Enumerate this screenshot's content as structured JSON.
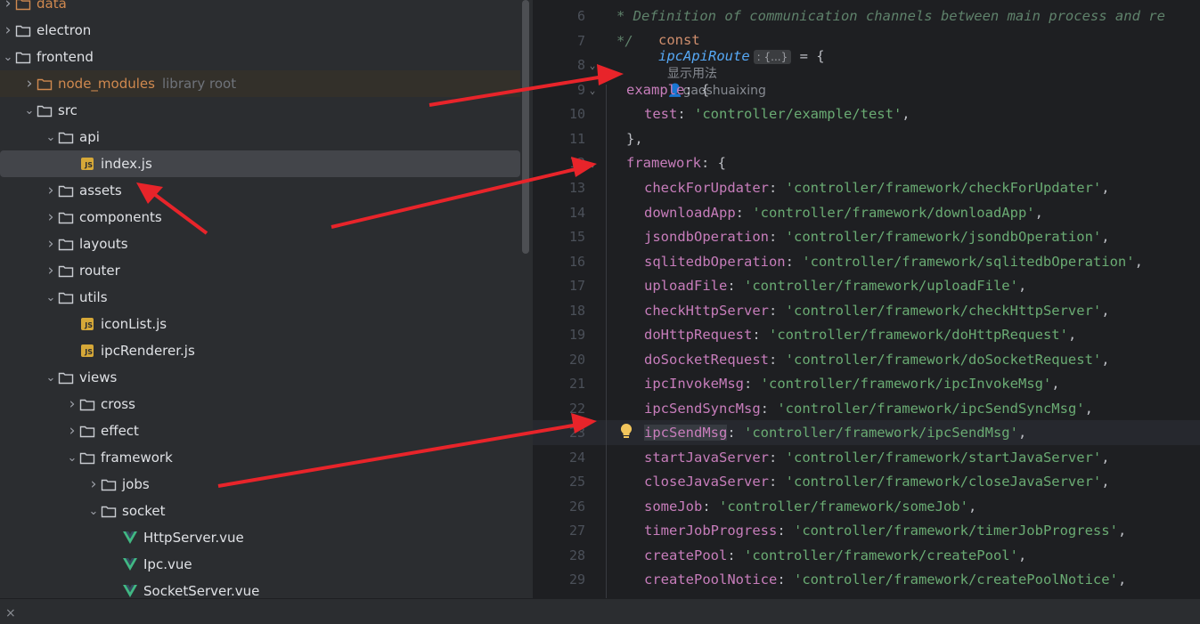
{
  "project_tree": {
    "items": [
      {
        "label": "data",
        "kind": "folder",
        "depth": 0,
        "expanded": false,
        "color": "orange"
      },
      {
        "label": "electron",
        "kind": "folder",
        "depth": 0,
        "expanded": false
      },
      {
        "label": "frontend",
        "kind": "folder",
        "depth": 0,
        "expanded": true
      },
      {
        "label": "node_modules",
        "kind": "folder",
        "depth": 1,
        "expanded": false,
        "color": "orange",
        "hint": "library root"
      },
      {
        "label": "src",
        "kind": "folder",
        "depth": 1,
        "expanded": true
      },
      {
        "label": "api",
        "kind": "folder",
        "depth": 2,
        "expanded": true
      },
      {
        "label": "index.js",
        "kind": "js",
        "depth": 3,
        "selected": true
      },
      {
        "label": "assets",
        "kind": "folder",
        "depth": 2,
        "expanded": false
      },
      {
        "label": "components",
        "kind": "folder",
        "depth": 2,
        "expanded": false
      },
      {
        "label": "layouts",
        "kind": "folder",
        "depth": 2,
        "expanded": false
      },
      {
        "label": "router",
        "kind": "folder",
        "depth": 2,
        "expanded": false
      },
      {
        "label": "utils",
        "kind": "folder",
        "depth": 2,
        "expanded": true
      },
      {
        "label": "iconList.js",
        "kind": "js",
        "depth": 3
      },
      {
        "label": "ipcRenderer.js",
        "kind": "js",
        "depth": 3
      },
      {
        "label": "views",
        "kind": "folder",
        "depth": 2,
        "expanded": true
      },
      {
        "label": "cross",
        "kind": "folder",
        "depth": 3,
        "expanded": false
      },
      {
        "label": "effect",
        "kind": "folder",
        "depth": 3,
        "expanded": false
      },
      {
        "label": "framework",
        "kind": "folder",
        "depth": 3,
        "expanded": true
      },
      {
        "label": "jobs",
        "kind": "folder",
        "depth": 4,
        "expanded": false
      },
      {
        "label": "socket",
        "kind": "folder",
        "depth": 4,
        "expanded": true
      },
      {
        "label": "HttpServer.vue",
        "kind": "vue",
        "depth": 5
      },
      {
        "label": "Ipc.vue",
        "kind": "vue",
        "depth": 5
      },
      {
        "label": "SocketServer.vue",
        "kind": "vue",
        "depth": 5
      }
    ]
  },
  "editor": {
    "comment_6": "* Definition of communication channels between main process and re",
    "comment_7": "*/",
    "kw_const": "const",
    "decl_name": "ipcApiRoute",
    "inlay_type": ": {...}",
    "decl_tail": " = {",
    "usage_hint": "显示用法",
    "author_hint": "gaoshuaixing",
    "example_key": "example",
    "example_open": ": {",
    "test_key": "test",
    "test_val": "'controller/example/test'",
    "close_brace": "},",
    "framework_key": "framework",
    "framework_open": ": {",
    "sep": ": ",
    "comma": ",",
    "entries": [
      {
        "line": 13,
        "key": "checkForUpdater",
        "value": "'controller/framework/checkForUpdater'"
      },
      {
        "line": 14,
        "key": "downloadApp",
        "value": "'controller/framework/downloadApp'"
      },
      {
        "line": 15,
        "key": "jsondbOperation",
        "value": "'controller/framework/jsondbOperation'"
      },
      {
        "line": 16,
        "key": "sqlitedbOperation",
        "value": "'controller/framework/sqlitedbOperation'"
      },
      {
        "line": 17,
        "key": "uploadFile",
        "value": "'controller/framework/uploadFile'"
      },
      {
        "line": 18,
        "key": "checkHttpServer",
        "value": "'controller/framework/checkHttpServer'"
      },
      {
        "line": 19,
        "key": "doHttpRequest",
        "value": "'controller/framework/doHttpRequest'"
      },
      {
        "line": 20,
        "key": "doSocketRequest",
        "value": "'controller/framework/doSocketRequest'"
      },
      {
        "line": 21,
        "key": "ipcInvokeMsg",
        "value": "'controller/framework/ipcInvokeMsg'"
      },
      {
        "line": 22,
        "key": "ipcSendSyncMsg",
        "value": "'controller/framework/ipcSendSyncMsg'"
      },
      {
        "line": 23,
        "key": "ipcSendMsg",
        "value": "'controller/framework/ipcSendMsg'",
        "current": true
      },
      {
        "line": 24,
        "key": "startJavaServer",
        "value": "'controller/framework/startJavaServer'"
      },
      {
        "line": 25,
        "key": "closeJavaServer",
        "value": "'controller/framework/closeJavaServer'"
      },
      {
        "line": 26,
        "key": "someJob",
        "value": "'controller/framework/someJob'"
      },
      {
        "line": 27,
        "key": "timerJobProgress",
        "value": "'controller/framework/timerJobProgress'"
      },
      {
        "line": 28,
        "key": "createPool",
        "value": "'controller/framework/createPool'"
      },
      {
        "line": 29,
        "key": "createPoolNotice",
        "value": "'controller/framework/createPoolNotice'"
      }
    ],
    "line_numbers": {
      "l6": "6",
      "l7": "7",
      "l8": "8",
      "l9": "9",
      "l10": "10",
      "l11": "11",
      "l12": "12"
    }
  },
  "statusbar": {
    "close_glyph": "×"
  },
  "colors": {
    "annotation_arrow": "#e8242a",
    "string": "#6aab73",
    "property": "#c77dbb",
    "keyword": "#cf8e6d"
  }
}
